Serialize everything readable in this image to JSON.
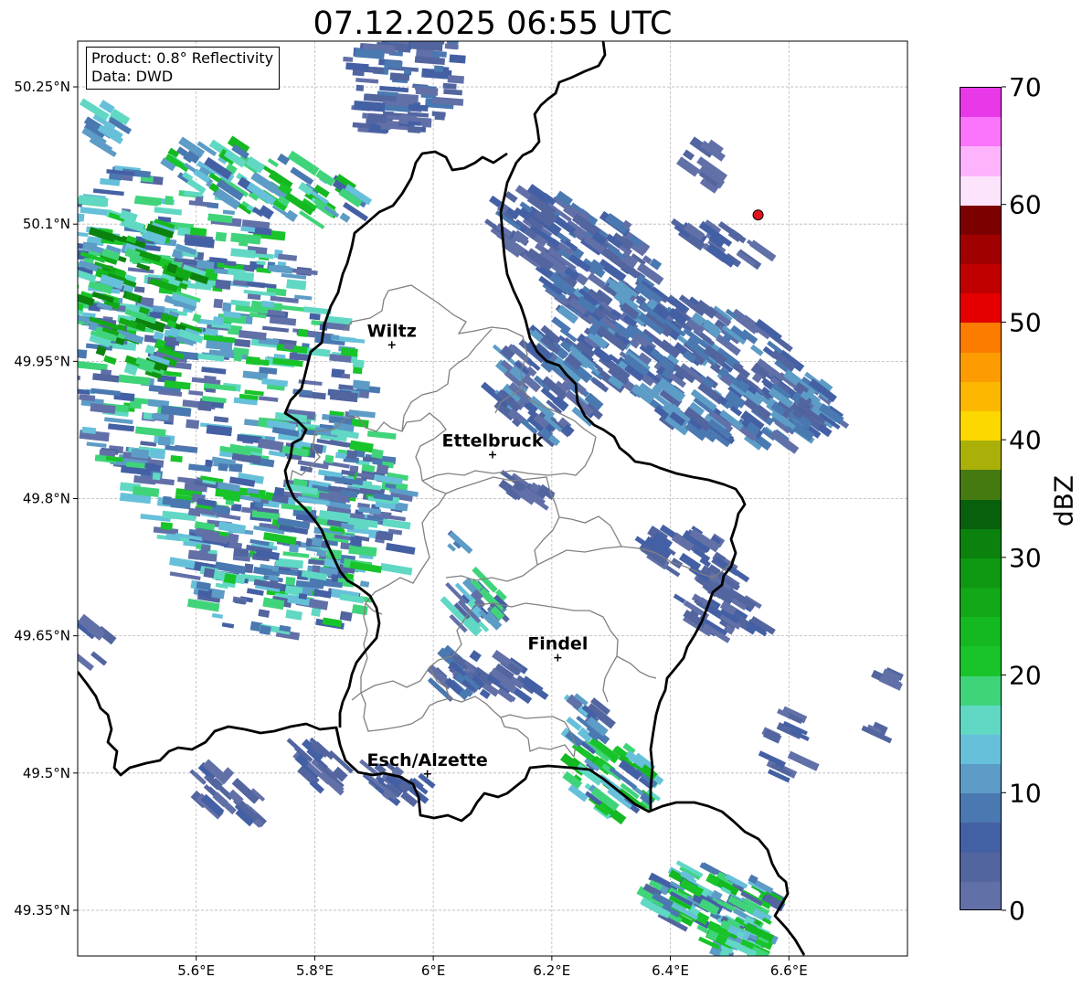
{
  "title": "07.12.2025 06:55 UTC",
  "info_box": {
    "product": "Product: 0.8° Reflectivity",
    "source": "Data: DWD"
  },
  "map": {
    "lon_range": [
      5.4,
      6.8
    ],
    "lat_range": [
      49.3,
      50.3
    ],
    "x_ticks": [
      {
        "value": 5.6,
        "label": "5.6°E"
      },
      {
        "value": 5.8,
        "label": "5.8°E"
      },
      {
        "value": 6.0,
        "label": "6°E"
      },
      {
        "value": 6.2,
        "label": "6.2°E"
      },
      {
        "value": 6.4,
        "label": "6.4°E"
      },
      {
        "value": 6.6,
        "label": "6.6°E"
      }
    ],
    "y_ticks": [
      {
        "value": 50.25,
        "label": "50.25°N"
      },
      {
        "value": 50.1,
        "label": "50.1°N"
      },
      {
        "value": 49.95,
        "label": "49.95°N"
      },
      {
        "value": 49.8,
        "label": "49.8°N"
      },
      {
        "value": 49.65,
        "label": "49.65°N"
      },
      {
        "value": 49.5,
        "label": "49.5°N"
      },
      {
        "value": 49.35,
        "label": "49.35°N"
      }
    ],
    "grid": true,
    "cities": [
      {
        "name": "Wiltz",
        "lon": 5.93,
        "lat": 49.968
      },
      {
        "name": "Ettelbruck",
        "lon": 6.1,
        "lat": 49.848
      },
      {
        "name": "Findel",
        "lon": 6.21,
        "lat": 49.626
      },
      {
        "name": "Esch/Alzette",
        "lon": 5.99,
        "lat": 49.499
      }
    ],
    "radar_site": {
      "lon": 6.548,
      "lat": 50.11,
      "color": "#e0141e"
    }
  },
  "colorbar": {
    "label": "dBZ",
    "min": 0,
    "max": 70,
    "tick_values": [
      0,
      10,
      20,
      30,
      40,
      50,
      60,
      70
    ],
    "tick_labels": [
      "0",
      "10",
      "20",
      "30",
      "40",
      "50",
      "60",
      "70"
    ],
    "colors": [
      "#6270a8",
      "#52659f",
      "#4460a4",
      "#4a78b0",
      "#5c9cc6",
      "#66c0da",
      "#60d8c4",
      "#40d47a",
      "#18c42a",
      "#14b820",
      "#12a818",
      "#0e9812",
      "#0c820e",
      "#08600c",
      "#447a10",
      "#aab008",
      "#fcd800",
      "#fcb800",
      "#fc9c00",
      "#fc7c00",
      "#e40000",
      "#c00000",
      "#a00000",
      "#7c0000",
      "#fde4fd",
      "#fdb4fd",
      "#fc74fc",
      "#e838e8"
    ]
  }
}
